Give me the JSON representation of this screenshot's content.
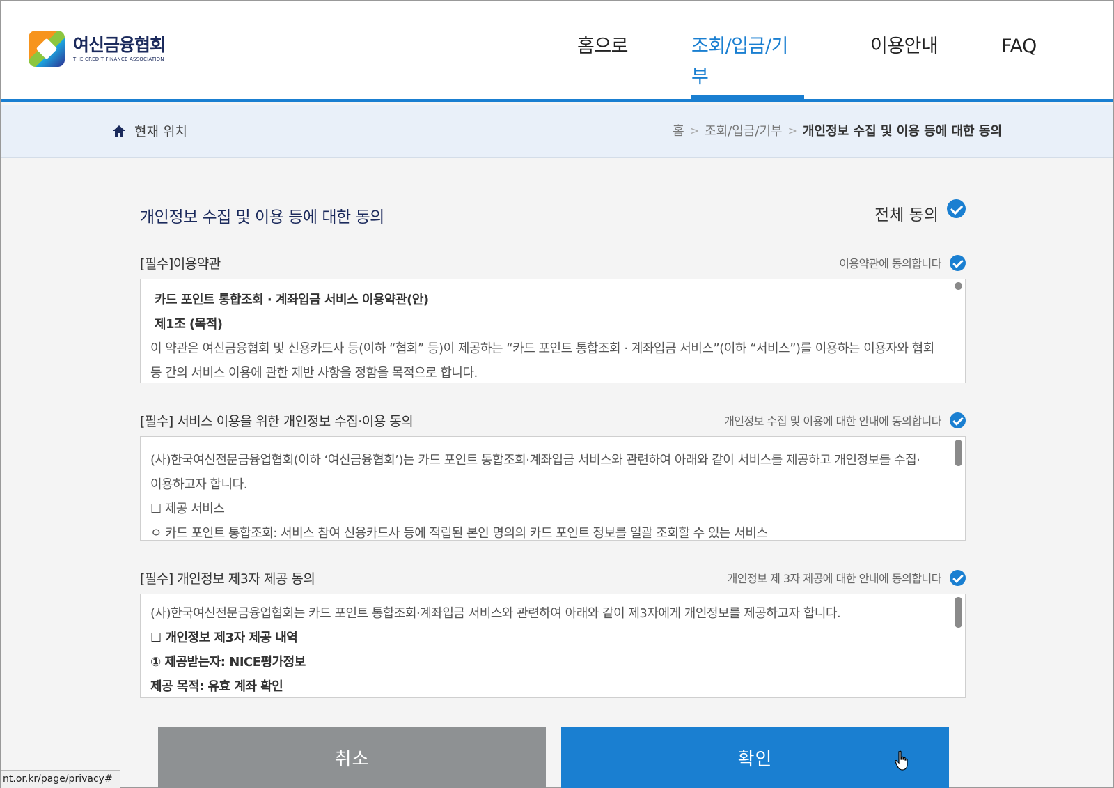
{
  "header": {
    "logo_kr": "여신금융협회",
    "logo_en": "THE CREDIT FINANCE ASSOCIATION",
    "nav": [
      {
        "label": "홈으로"
      },
      {
        "label": "조회/입금/기부"
      },
      {
        "label": "이용안내"
      },
      {
        "label": "FAQ"
      }
    ],
    "active_color": "#1a7fd1"
  },
  "location": {
    "label": "현재 위치",
    "crumbs": [
      "홈",
      "조회/입금/기부",
      "개인정보 수집 및 이용 등에 대한 동의"
    ]
  },
  "main": {
    "title": "개인정보 수집 및 이용 등에 대한 동의",
    "all_agree": "전체 동의",
    "sections": [
      {
        "title": "[필수]이용약관",
        "agree": "이용약관에 동의합니다",
        "lines": [
          "카드 포인트 통합조회 · 계좌입금 서비스 이용약관(안)",
          "제1조 (목적)",
          "이 약관은 여신금융협회 및 신용카드사 등(이하 “협회” 등)이 제공하는 “카드 포인트 통합조회 · 계좌입금 서비스”(이하 “서비스”)를 이용하는 이용자와 협회",
          "등 간의 서비스 이용에 관한 제반 사항을 정함을 목적으로 합니다."
        ]
      },
      {
        "title": "[필수] 서비스 이용을 위한 개인정보 수집·이용 동의",
        "agree": "개인정보 수집 및 이용에 대한 안내에 동의합니다",
        "lines": [
          "(사)한국여신전문금융업협회(이하 ‘여신금융협회’)는 카드 포인트 통합조회·계좌입금 서비스와 관련하여 아래와 같이 서비스를 제공하고 개인정보를 수집·",
          "이용하고자 합니다.",
          "☐ 제공 서비스",
          "ㅇ 카드 포인트 통합조회: 서비스 참여 신용카드사 등에 적립된 본인 명의의 카드 포인트 정보를 일괄 조회할 수 있는 서비스"
        ]
      },
      {
        "title": "[필수] 개인정보 제3자 제공 동의",
        "agree": "개인정보 제 3자 제공에 대한 안내에 동의합니다",
        "lines": [
          "(사)한국여신전문금융업협회는 카드 포인트 통합조회·계좌입금 서비스와 관련하여 아래와 같이 제3자에게 개인정보를 제공하고자 합니다.",
          "☐ 개인정보 제3자 제공 내역",
          "① 제공받는자: NICE평가정보",
          "제공 목적: 유효 계좌 확인"
        ]
      }
    ]
  },
  "buttons": {
    "cancel": "취소",
    "ok": "확인"
  },
  "status_url": "nt.or.kr/page/privacy#"
}
